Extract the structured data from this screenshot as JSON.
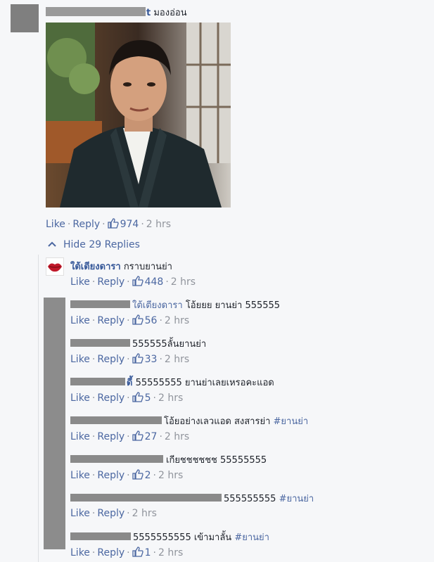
{
  "thread": {
    "author_suffix": "t",
    "text": "มองอ่อน",
    "actions": {
      "like": "Like",
      "reply": "Reply",
      "count": "974",
      "time": "2 hrs"
    },
    "hide_replies": "Hide 29 Replies"
  },
  "replies": [
    {
      "author": "ใต้เตียงดารา",
      "text": "กราบยานย่า",
      "like": "Like",
      "reply": "Reply",
      "count": "448",
      "time": "2 hrs"
    },
    {
      "mention": "ใต้เตียงดารา",
      "text": "โอ้ยยย ยานย่า 555555",
      "like": "Like",
      "reply": "Reply",
      "count": "56",
      "time": "2 hrs"
    },
    {
      "text": "555555ลั้นยานย่า",
      "like": "Like",
      "reply": "Reply",
      "count": "33",
      "time": "2 hrs"
    },
    {
      "author_suffix": "ดี้",
      "text": "55555555 ยานย่าเลยเหรอคะแอด",
      "like": "Like",
      "reply": "Reply",
      "count": "5",
      "time": "2 hrs"
    },
    {
      "text": "โอ้ยอย่างเลวแอด สงสารย่า",
      "hashtag": "#ยานย่า",
      "like": "Like",
      "reply": "Reply",
      "count": "27",
      "time": "2 hrs"
    },
    {
      "text": "เกียชชชชชช 55555555",
      "like": "Like",
      "reply": "Reply",
      "count": "2",
      "time": "2 hrs"
    },
    {
      "text": "555555555",
      "hashtag": "#ยานย่า",
      "like": "Like",
      "reply": "Reply",
      "time": "2 hrs"
    },
    {
      "text": "5555555555 เข้ามาลั้น",
      "hashtag": "#ยานย่า",
      "like": "Like",
      "reply": "Reply",
      "count": "1",
      "time": "2 hrs"
    }
  ],
  "colors": {
    "link": "#4b67a1",
    "name": "#365899",
    "meta": "#90949c",
    "background": "#f6f7f9"
  },
  "icons": {
    "like_count": "thumbs-up-icon",
    "hide": "chevron-up-icon",
    "avatar": "lips-icon"
  }
}
